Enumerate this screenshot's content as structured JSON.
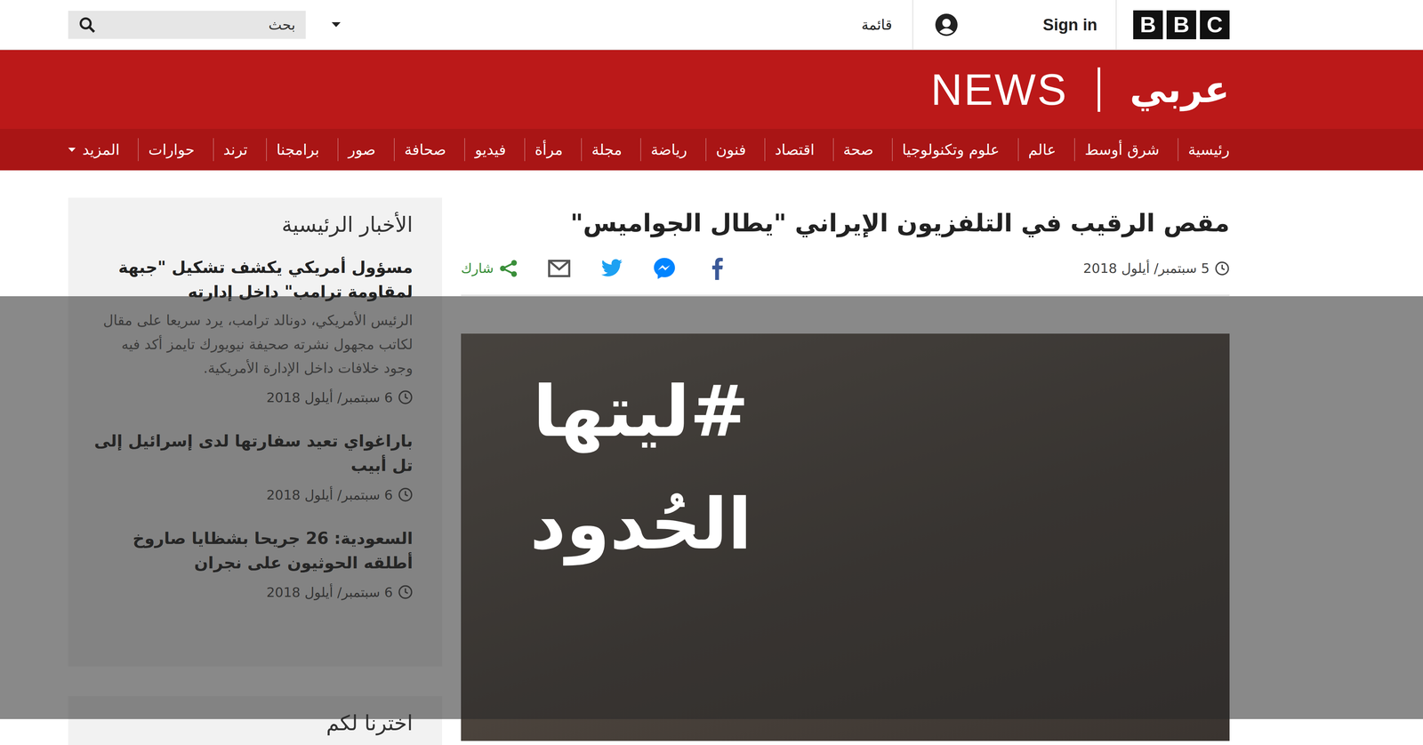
{
  "topbar": {
    "logo_letters": [
      "B",
      "B",
      "C"
    ],
    "sign_in": "Sign in",
    "menu": "قائمة",
    "search_placeholder": "بحث"
  },
  "header": {
    "news": "NEWS",
    "language": "عربي"
  },
  "nav": [
    {
      "label": "رئيسية"
    },
    {
      "label": "شرق أوسط"
    },
    {
      "label": "عالم"
    },
    {
      "label": "علوم وتكنولوجيا"
    },
    {
      "label": "صحة"
    },
    {
      "label": "اقتصاد"
    },
    {
      "label": "فنون"
    },
    {
      "label": "رياضة"
    },
    {
      "label": "مجلة"
    },
    {
      "label": "مرأة"
    },
    {
      "label": "فيديو"
    },
    {
      "label": "صحافة"
    },
    {
      "label": "صور"
    },
    {
      "label": "برامجنا"
    },
    {
      "label": "ترند"
    },
    {
      "label": "حوارات"
    }
  ],
  "nav_more": "المزيد",
  "article": {
    "title": "مقص الرقيب في التلفزيون الإيراني \"يطال الجواميس\"",
    "date": "5 سبتمبر/ أيلول 2018",
    "share": "شارك"
  },
  "sidebar": {
    "heading": "الأخبار الرئيسية",
    "items": [
      {
        "title": "مسؤول أمريكي يكشف تشكيل \"جبهة لمقاومة ترامب\" داخل إدارته",
        "summary": "الرئيس الأمريكي، دونالد ترامب، يرد سريعا على مقال لكاتب مجهول نشرته صحيفة نيويورك تايمز أكد فيه وجود خلافات داخل الإدارة الأمريكية.",
        "date": "6 سبتمبر/ أيلول 2018"
      },
      {
        "title": "باراغواي تعيد سفارتها لدى إسرائيل إلى تل أبيب",
        "summary": "",
        "date": "6 سبتمبر/ أيلول 2018"
      },
      {
        "title": "السعودية: 26 جريحا بشظايا صاروخ أطلقه الحوثيون على نجران",
        "summary": "",
        "date": "6 سبتمبر/ أيلول 2018"
      }
    ],
    "second_heading": "اخترنا لكم"
  },
  "overlay": {
    "hashtag_lines": [
      "#ليتها",
      "الحُدود"
    ]
  }
}
